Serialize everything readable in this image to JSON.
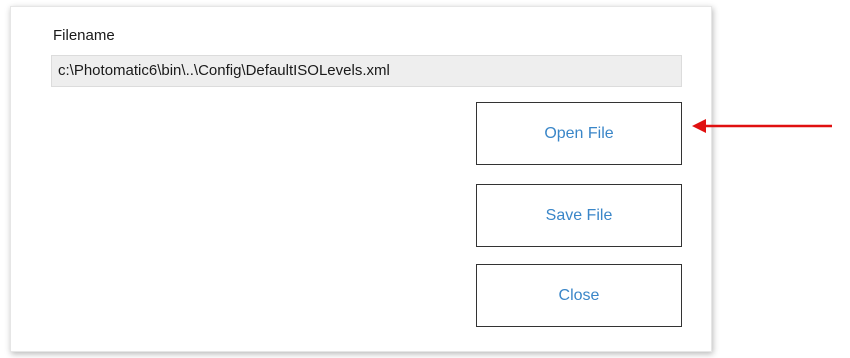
{
  "dialog": {
    "filename_label": "Filename",
    "filename_value": "c:\\Photomatic6\\bin\\..\\Config\\DefaultISOLevels.xml",
    "buttons": {
      "open": "Open File",
      "save": "Save File",
      "close": "Close"
    }
  },
  "annotation": {
    "arrow_color": "#e01010",
    "arrow_target": "Open File"
  },
  "colors": {
    "button_text": "#3a86c8",
    "field_background": "#eeeeee"
  }
}
